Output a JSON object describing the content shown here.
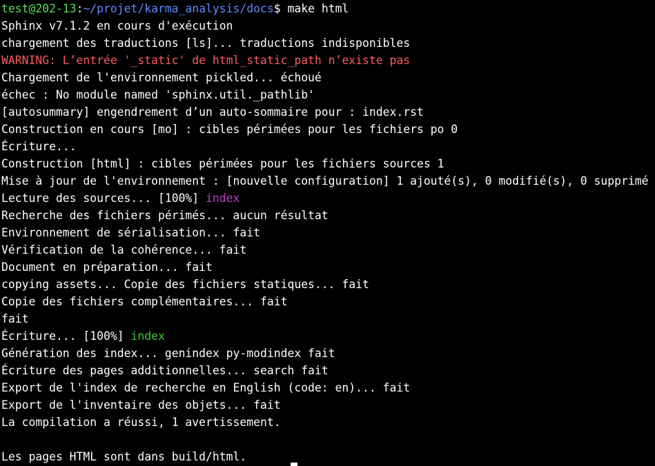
{
  "colors": {
    "background": "#000000",
    "text": "#ffffff",
    "prompt_user": "#4ee44e",
    "prompt_path": "#5b8cff",
    "warning": "#ff5a5a",
    "magenta": "#c43ac4",
    "green": "#33cc33"
  },
  "prompt": {
    "user_host": "test@202-13",
    "colon": ":",
    "path": "~/projet/karma_analysis/docs",
    "dollar": "$",
    "command": " make html"
  },
  "output": {
    "l01": "Sphinx v7.1.2 en cours d'exécution",
    "l02": "chargement des traductions [ls]... traductions indisponibles",
    "l03": "WARNING: L’entrée '_static' de html_static_path n’existe pas",
    "l04": "Chargement de l'environnement pickled... échoué",
    "l05": "échec : No module named 'sphinx.util._pathlib'",
    "l06": "[autosummary] engendrement d’un auto-sommaire pour : index.rst",
    "l07": "Construction en cours [mo] : cibles périmées pour les fichiers po 0",
    "l08": "Écriture...",
    "l09": "Construction [html] : cibles périmées pour les fichiers sources 1",
    "l10": "Mise à jour de l'environnement : [nouvelle configuration] 1 ajouté(s), 0 modifié(s), 0 supprimé",
    "l11_prefix": "Lecture des sources... [100%] ",
    "l11_item": "index",
    "l12": "Recherche des fichiers périmés... aucun résultat",
    "l13": "Environnement de sérialisation... fait",
    "l14": "Vérification de la cohérence... fait",
    "l15": "Document en préparation... fait",
    "l16": "copying assets... Copie des fichiers statiques... fait",
    "l17": "Copie des fichiers complémentaires... fait",
    "l18": "fait",
    "l19_prefix": "Écriture... [100%] ",
    "l19_item": "index",
    "l20": "Génération des index... genindex py-modindex fait",
    "l21": "Écriture des pages additionnelles... search fait",
    "l22": "Export de l'index de recherche en English (code: en)... fait",
    "l23": "Export de l'inventaire des objets... fait",
    "l24": "La compilation a réussi, 1 avertissement.",
    "l25": "",
    "l26": "Les pages HTML sont dans build/html."
  }
}
